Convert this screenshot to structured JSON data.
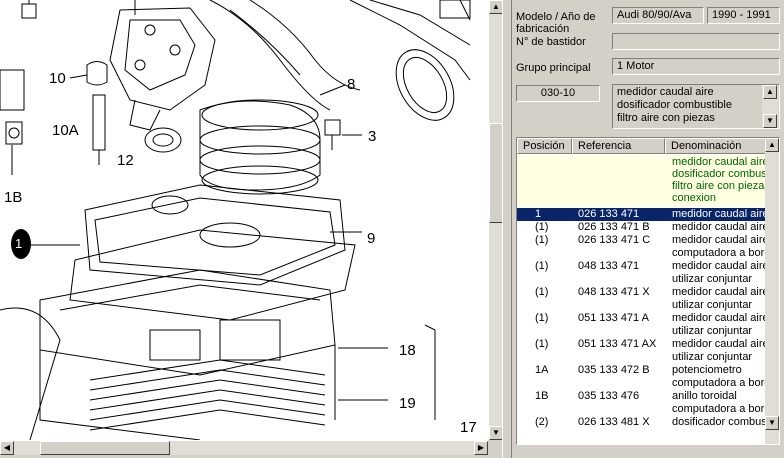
{
  "diagram": {
    "callouts": [
      "10",
      "10A",
      "1B",
      "12",
      "8",
      "3",
      "9",
      "18",
      "19",
      "17"
    ],
    "highlight_callout": "1"
  },
  "info": {
    "model_label_line1": "Modelo / Año de",
    "model_label_line2": "fabricación",
    "chassis_label": "N° de bastidor",
    "model_value": "Audi 80/90/Ava",
    "years_value": "1990 - 1991",
    "chassis_value": "",
    "main_group_label": "Grupo principal",
    "main_group_value": "1   Motor",
    "subgroup_code": "030-10",
    "subgroup_lines": [
      "medidor caudal aire",
      "dosificador  combustible",
      "filtro aire con piezas"
    ]
  },
  "table": {
    "headers": [
      "Posición",
      "Referencia",
      "Denominación"
    ],
    "group_desc": [
      "medidor caudal aire",
      "dosificador  combus",
      "filtro aire con piezas",
      "conexion"
    ],
    "rows": [
      {
        "pos": "1",
        "ref": "026 133 471",
        "den": "medidor caudal aire",
        "sel": true
      },
      {
        "pos": "(1)",
        "ref": "026 133 471 B",
        "den": "medidor caudal aire"
      },
      {
        "pos": "(1)",
        "ref": "026 133 471 C",
        "den": "medidor caudal aire"
      },
      {
        "pos": "",
        "ref": "",
        "den": "computadora a bord"
      },
      {
        "pos": "(1)",
        "ref": "048 133 471",
        "den": "medidor caudal aire"
      },
      {
        "pos": "",
        "ref": "",
        "den": "    utilizar conjuntar"
      },
      {
        "pos": "(1)",
        "ref": "048 133 471  X",
        "den": "medidor caudal aire"
      },
      {
        "pos": "",
        "ref": "",
        "den": "    utilizar conjuntar"
      },
      {
        "pos": "(1)",
        "ref": "051 133 471 A",
        "den": "medidor caudal aire"
      },
      {
        "pos": "",
        "ref": "",
        "den": "    utilizar conjuntar"
      },
      {
        "pos": "(1)",
        "ref": "051 133 471 AX",
        "den": "medidor caudal aire"
      },
      {
        "pos": "",
        "ref": "",
        "den": "    utilizar conjuntar"
      },
      {
        "pos": "1A",
        "ref": "035 133 472 B",
        "den": "potenciometro"
      },
      {
        "pos": "",
        "ref": "",
        "den": "computadora a bord"
      },
      {
        "pos": "1B",
        "ref": "035 133 476",
        "den": "anillo toroidal"
      },
      {
        "pos": "",
        "ref": "",
        "den": "computadora a bord"
      },
      {
        "pos": "(2)",
        "ref": "026 133 481  X",
        "den": "dosificador  combus"
      }
    ]
  }
}
